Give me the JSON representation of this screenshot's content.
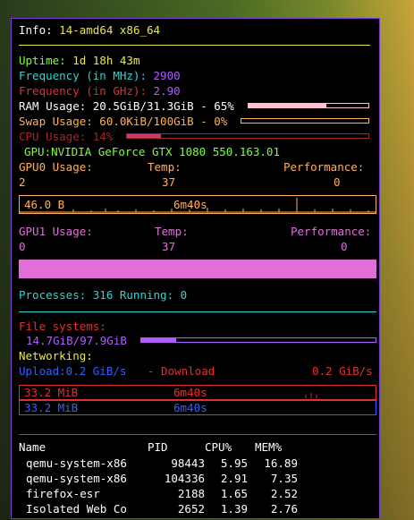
{
  "info": {
    "label": "Info:",
    "value": "14-amd64 x86_64"
  },
  "uptime": {
    "label": "Uptime:",
    "value": "1d 18h 43m"
  },
  "freq_mhz": {
    "label": "Frequency (in MHz):",
    "value": "2900"
  },
  "freq_ghz": {
    "label": "Frequency (in GHz):",
    "value": "2.90"
  },
  "ram": {
    "text": "RAM Usage: 20.5GiB/31.3GiB - 65%",
    "percent": 65
  },
  "swap": {
    "text": "Swap Usage: 60.0KiB/100GiB - 0%",
    "percent": 0
  },
  "cpu": {
    "text": "CPU Usage: 14%",
    "percent": 14
  },
  "gpu": {
    "name": "GPU:NVIDIA GeForce GTX 1080 550.163.01",
    "gpu0": {
      "usage_label": "GPU0 Usage:",
      "temp_label": "Temp:",
      "perf_label": "Performance:",
      "usage": "2",
      "temp": "37",
      "perf": "0",
      "graph_max": "46.0 B",
      "graph_time": "6m40s"
    },
    "gpu1": {
      "usage_label": "GPU1 Usage:",
      "temp_label": "Temp:",
      "perf_label": "Performance:",
      "usage": "0",
      "temp": "37",
      "perf": "0"
    }
  },
  "processes": {
    "text": "Processes: 316 Running: 0"
  },
  "filesystems": {
    "label": "File systems:",
    "usage": "14.7GiB/97.9GiB",
    "percent": 15
  },
  "networking": {
    "label": "Networking:",
    "upload": "Upload:0.2 GiB/s",
    "download_label": "- Download",
    "download": "0.2 GiB/s",
    "down_graph_max": "33.2 MiB",
    "down_graph_time": "6m40s",
    "up_graph_max": "33.2 MiB",
    "up_graph_time": "6m40s"
  },
  "table": {
    "headers": [
      "Name",
      "PID",
      "CPU%",
      "MEM%"
    ],
    "rows": [
      [
        "qemu-system-x86",
        "98443",
        "5.95",
        "16.89"
      ],
      [
        "qemu-system-x86",
        "104336",
        "2.91",
        "7.35"
      ],
      [
        "firefox-esr",
        "2188",
        "1.65",
        "2.52"
      ],
      [
        "Isolated Web Co",
        "2652",
        "1.39",
        "2.76"
      ]
    ]
  },
  "colors": {
    "white": "#ffffff",
    "yellow": "#e8e84a",
    "green": "#7dff3a",
    "cyan": "#2fd4d4",
    "purple": "#b15cff",
    "red": "#e03030",
    "orange": "#ffb05a",
    "pink": "#e070d8",
    "blue": "#3060ff"
  }
}
